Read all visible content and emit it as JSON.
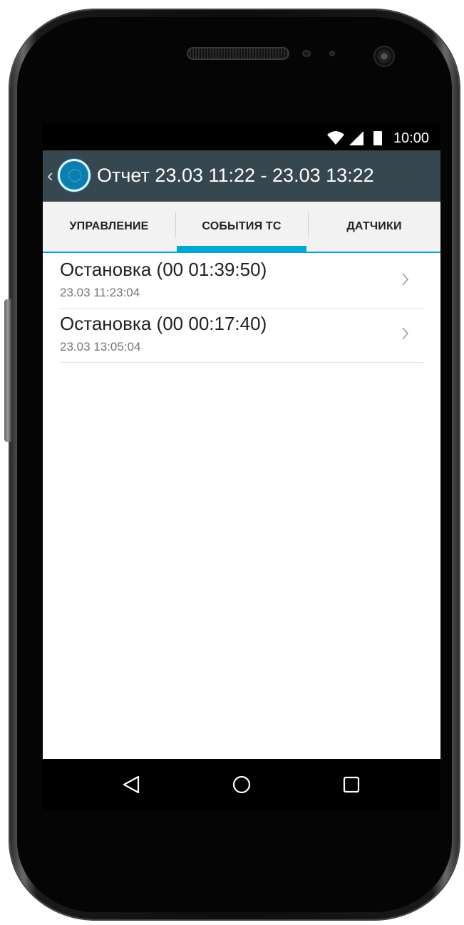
{
  "status_bar": {
    "time": "10:00",
    "icons": [
      "wifi-icon",
      "signal-icon",
      "battery-icon"
    ]
  },
  "action_bar": {
    "title": "Отчет 23.03 11:22 - 23.03 13:22",
    "background_color": "#37474f",
    "icons": [
      "back-chevron-icon",
      "app-logo"
    ]
  },
  "tabs": [
    {
      "label": "УПРАВЛЕНИЕ",
      "selected": false
    },
    {
      "label": "СОБЫТИЯ ТС",
      "selected": true
    },
    {
      "label": "ДАТЧИКИ",
      "selected": false
    }
  ],
  "accent_color": "#00a9d4",
  "events": [
    {
      "title": "Остановка (00 01:39:50)",
      "timestamp": "23.03 11:23:04"
    },
    {
      "title": "Остановка (00 00:17:40)",
      "timestamp": "23.03 13:05:04"
    }
  ],
  "nav_bar": {
    "buttons": [
      "back-triangle-icon",
      "home-circle-icon",
      "recents-square-icon"
    ]
  }
}
